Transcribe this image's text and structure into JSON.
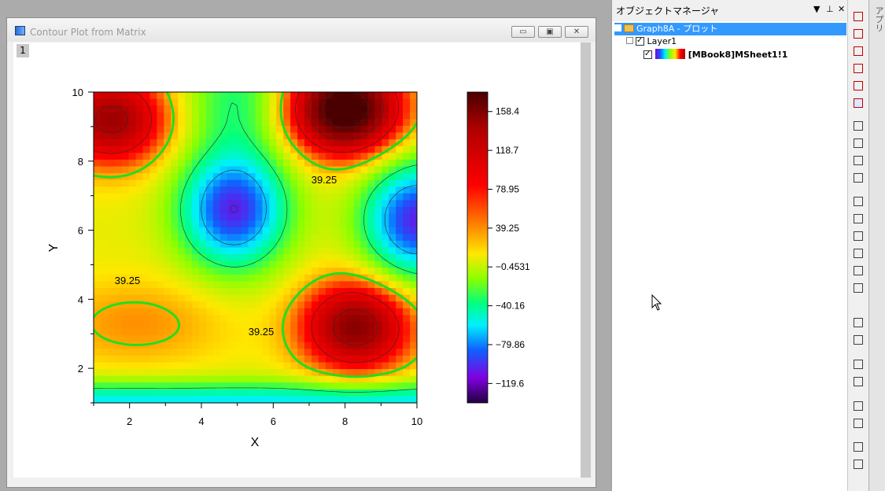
{
  "window": {
    "title": "Contour Plot from Matrix",
    "layer_tab": "1"
  },
  "chart_data": {
    "type": "heatmap",
    "xlabel": "X",
    "ylabel": "Y",
    "xlim": [
      1,
      10
    ],
    "ylim": [
      1,
      10
    ],
    "x_ticks": [
      "2",
      "4",
      "6",
      "8",
      "10"
    ],
    "y_ticks": [
      "2",
      "4",
      "6",
      "8",
      "10"
    ],
    "colorbar_ticks": [
      "158.4",
      "118.7",
      "78.95",
      "39.25",
      "−0.4531",
      "−40.16",
      "−79.86",
      "−119.6"
    ],
    "contour_labels": [
      "39.25",
      "39.25",
      "39.25"
    ],
    "highlighted_level": 39.25,
    "features": [
      {
        "x": 8.0,
        "y": 9.5,
        "z": 170,
        "kind": "peak"
      },
      {
        "x": 8.3,
        "y": 3.2,
        "z": 120,
        "kind": "peak"
      },
      {
        "x": 1.5,
        "y": 9.2,
        "z": 110,
        "kind": "peak"
      },
      {
        "x": 4.9,
        "y": 6.6,
        "z": -120,
        "kind": "valley"
      },
      {
        "x": 10.0,
        "y": 6.3,
        "z": -120,
        "kind": "valley"
      },
      {
        "x": 5.0,
        "y": 9.8,
        "z": -40,
        "kind": "valley"
      }
    ]
  },
  "object_manager": {
    "title": "オブジェクトマネージャ",
    "root": "Graph8A - プロット",
    "layer": "Layer1",
    "plot": "[MBook8]MSheet1!1"
  },
  "apps_tab": {
    "label": "アプリ"
  }
}
